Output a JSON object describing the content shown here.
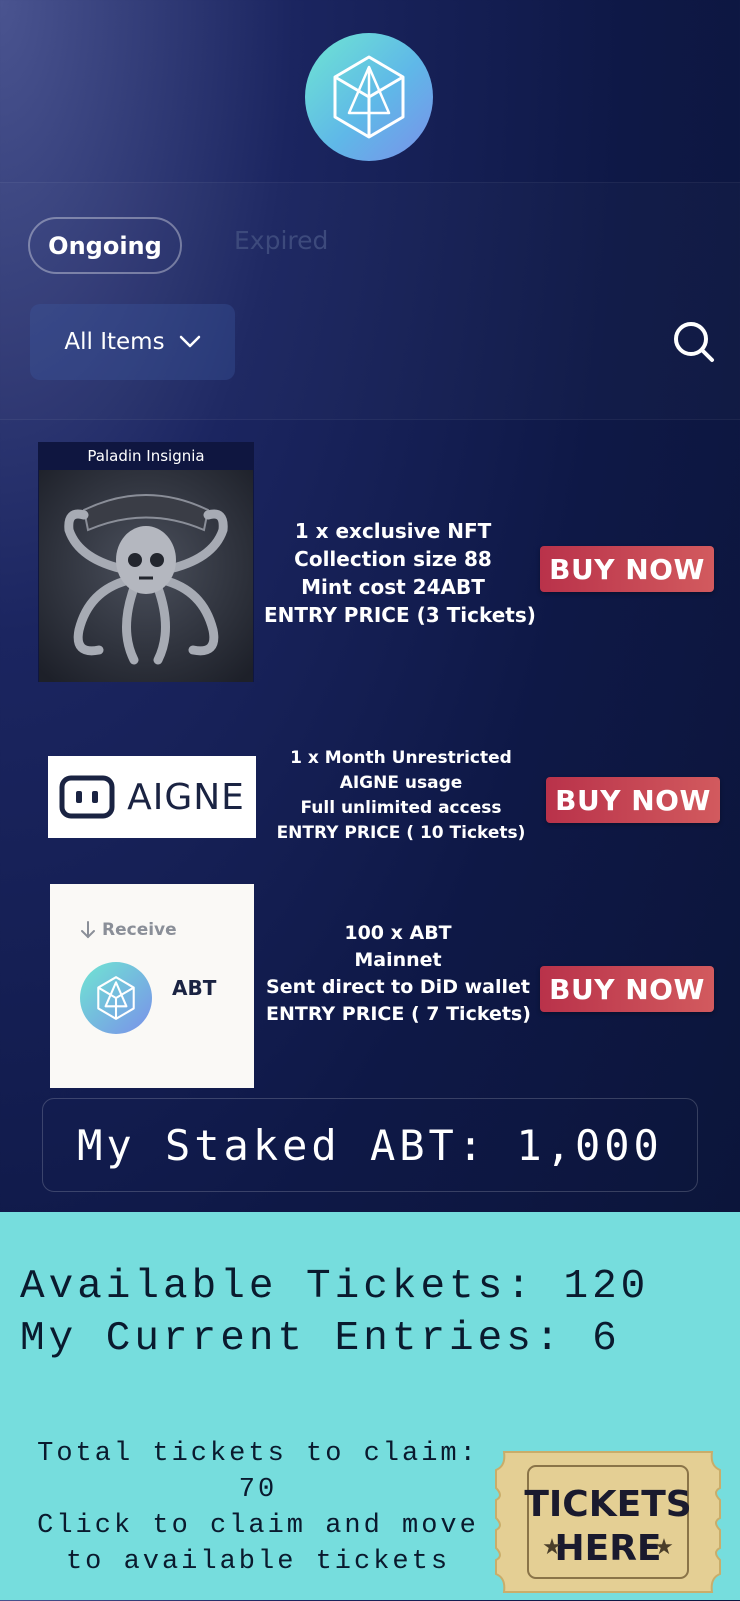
{
  "tabs": {
    "ongoing": "Ongoing",
    "expired": "Expired"
  },
  "filter": {
    "label": "All Items"
  },
  "items": [
    {
      "caption": "Paladin Insignia",
      "lines": [
        "1 x exclusive NFT",
        "Collection size 88",
        "Mint cost 24ABT",
        "ENTRY PRICE (3 Tickets)"
      ],
      "button": "BUY NOW"
    },
    {
      "logo_text": "AIGNE",
      "lines": [
        "1 x Month Unrestricted",
        "AIGNE usage",
        "Full unlimited access",
        "ENTRY PRICE ( 10 Tickets)"
      ],
      "button": "BUY NOW"
    },
    {
      "receive_label": "Receive",
      "token": "ABT",
      "lines": [
        "100 x ABT",
        "Mainnet",
        "Sent direct to DiD wallet",
        "ENTRY PRICE ( 7 Tickets)"
      ],
      "button": "BUY NOW"
    }
  ],
  "staked": "My Staked ABT: 1,000",
  "stats": {
    "available": "Available Tickets:  120",
    "entries": "My Current Entries: 6"
  },
  "claim": {
    "line1": "Total tickets to claim:",
    "line2": "70",
    "line3": "Click to claim and move",
    "line4": "to available tickets"
  },
  "tickets_badge": {
    "line1": "TICKETS",
    "line2": "HERE"
  },
  "colors": {
    "accent": "#76dddd",
    "buy": "#c9424f",
    "bg": "#0e1846"
  }
}
